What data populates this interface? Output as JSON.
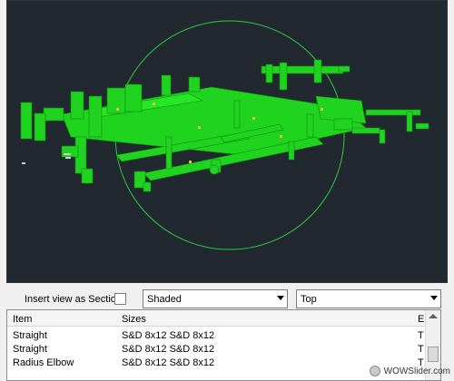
{
  "viewport": {
    "view_circle_color": "#2ecc40",
    "model_color": "#1fd31f",
    "background_color": "#212830"
  },
  "controls": {
    "section_label": "Insert view as Section",
    "section_checked": false,
    "style_value": "Shaded",
    "view_value": "Top"
  },
  "table": {
    "headers": {
      "item": "Item",
      "sizes": "Sizes",
      "el": "El"
    },
    "rows": [
      {
        "item": "Straight",
        "sizes": "S&D 8x12  S&D 8x12",
        "el": "T"
      },
      {
        "item": "Straight",
        "sizes": "S&D 8x12  S&D 8x12",
        "el": "T"
      },
      {
        "item": "Radius Elbow",
        "sizes": "S&D 8x12  S&D 8x12",
        "el": "T"
      }
    ]
  },
  "watermark": {
    "text": "WOWSlider.com"
  }
}
